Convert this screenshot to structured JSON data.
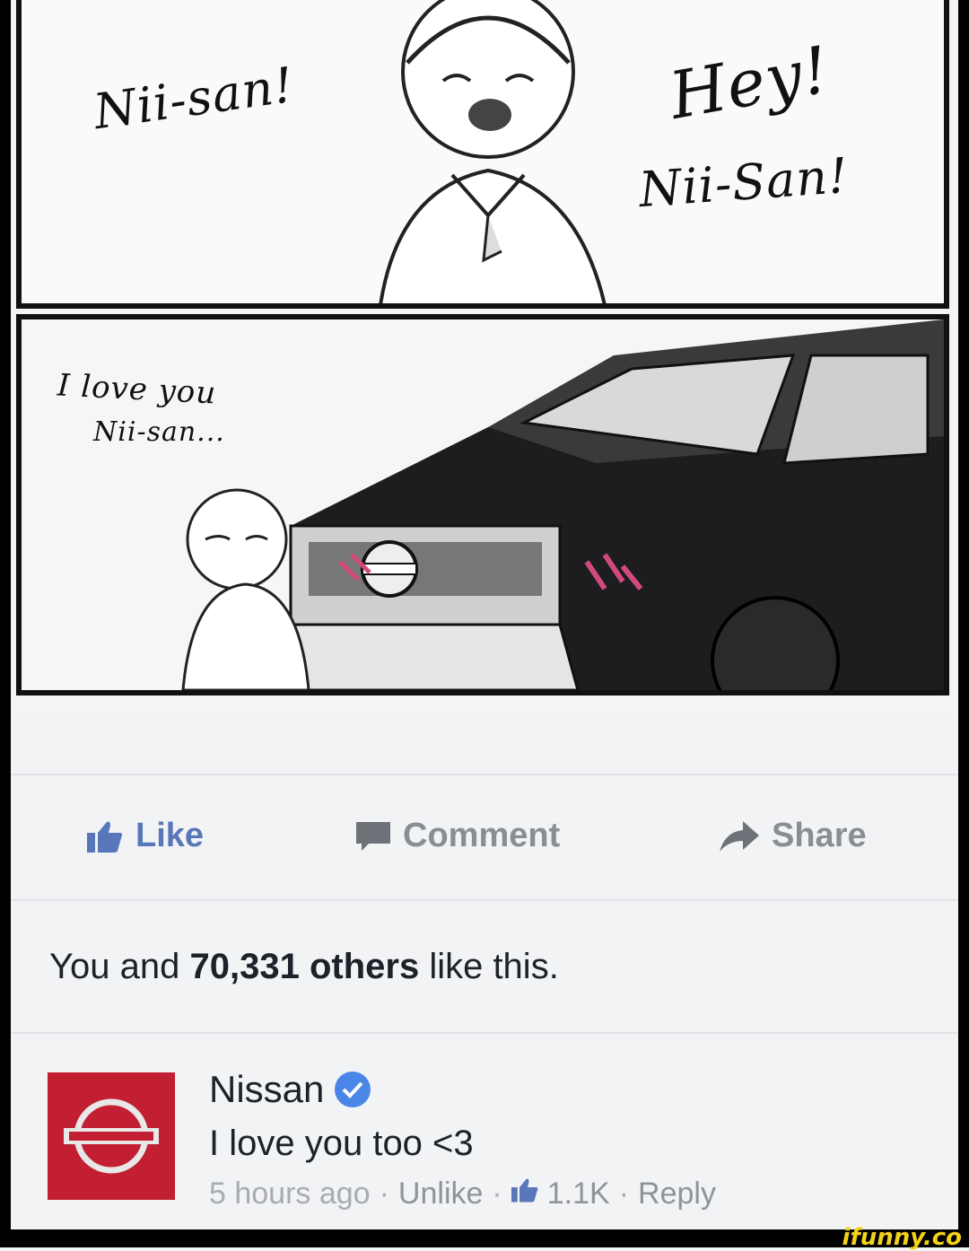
{
  "comic": {
    "panel1_texts": [
      "Nii-san!",
      "Hey!",
      "Nii-San!"
    ],
    "panel2_texts": [
      "I love you",
      "Nii-san..."
    ]
  },
  "actions": {
    "like_label": "Like",
    "comment_label": "Comment",
    "share_label": "Share"
  },
  "likes_summary": {
    "prefix": "You and",
    "count": "70,331 others",
    "suffix": "like this."
  },
  "comment": {
    "author": "Nissan",
    "text": "I love you too <3",
    "time": "5 hours ago",
    "unlike_label": "Unlike",
    "like_count": "1.1K",
    "reply_label": "Reply",
    "separator": "·"
  },
  "watermark": "ifunny.co",
  "colors": {
    "like_blue": "#5877b8",
    "nissan_red": "#c21f33",
    "verified_blue": "#4a86e8",
    "watermark_yellow": "#f3d21a"
  }
}
